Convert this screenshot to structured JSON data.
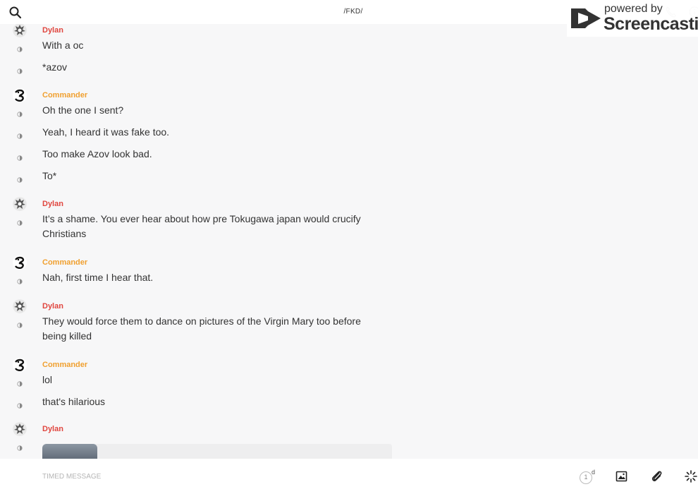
{
  "header": {
    "search_icon": "search-icon",
    "title": "/FKD/",
    "watermark": {
      "powered": "powered by",
      "brand": "Screencastify"
    }
  },
  "colors": {
    "dylan": "#e0463f",
    "commander": "#f0a030"
  },
  "groups": [
    {
      "sender": "Dylan",
      "messages": [
        {
          "lines": [
            "With a oc"
          ]
        },
        {
          "lines": [
            "*azov"
          ]
        }
      ]
    },
    {
      "sender": "Commander",
      "messages": [
        {
          "lines": [
            "Oh the one I sent?"
          ]
        },
        {
          "lines": [
            "Yeah, I heard it was fake too."
          ]
        },
        {
          "lines": [
            "Too make Azov look bad."
          ]
        },
        {
          "lines": [
            "To*"
          ]
        }
      ]
    },
    {
      "sender": "Dylan",
      "messages": [
        {
          "lines": [
            "It’s a shame. You ever hear about how pre Tokugawa japan would crucify",
            "Christians"
          ]
        }
      ]
    },
    {
      "sender": "Commander",
      "messages": [
        {
          "lines": [
            "Nah, first time I hear that."
          ]
        }
      ]
    },
    {
      "sender": "Dylan",
      "messages": [
        {
          "lines": [
            "They would force them to dance on pictures of the Virgin Mary too before",
            "being killed"
          ]
        }
      ]
    },
    {
      "sender": "Commander",
      "messages": [
        {
          "lines": [
            "lol"
          ]
        },
        {
          "lines": [
            "that's hilarious"
          ]
        }
      ]
    },
    {
      "sender": "Dylan",
      "messages": [
        {
          "image": true
        }
      ]
    }
  ],
  "composer": {
    "placeholder": "TIMED MESSAGE",
    "timer_value": "1",
    "timer_unit": "d"
  }
}
